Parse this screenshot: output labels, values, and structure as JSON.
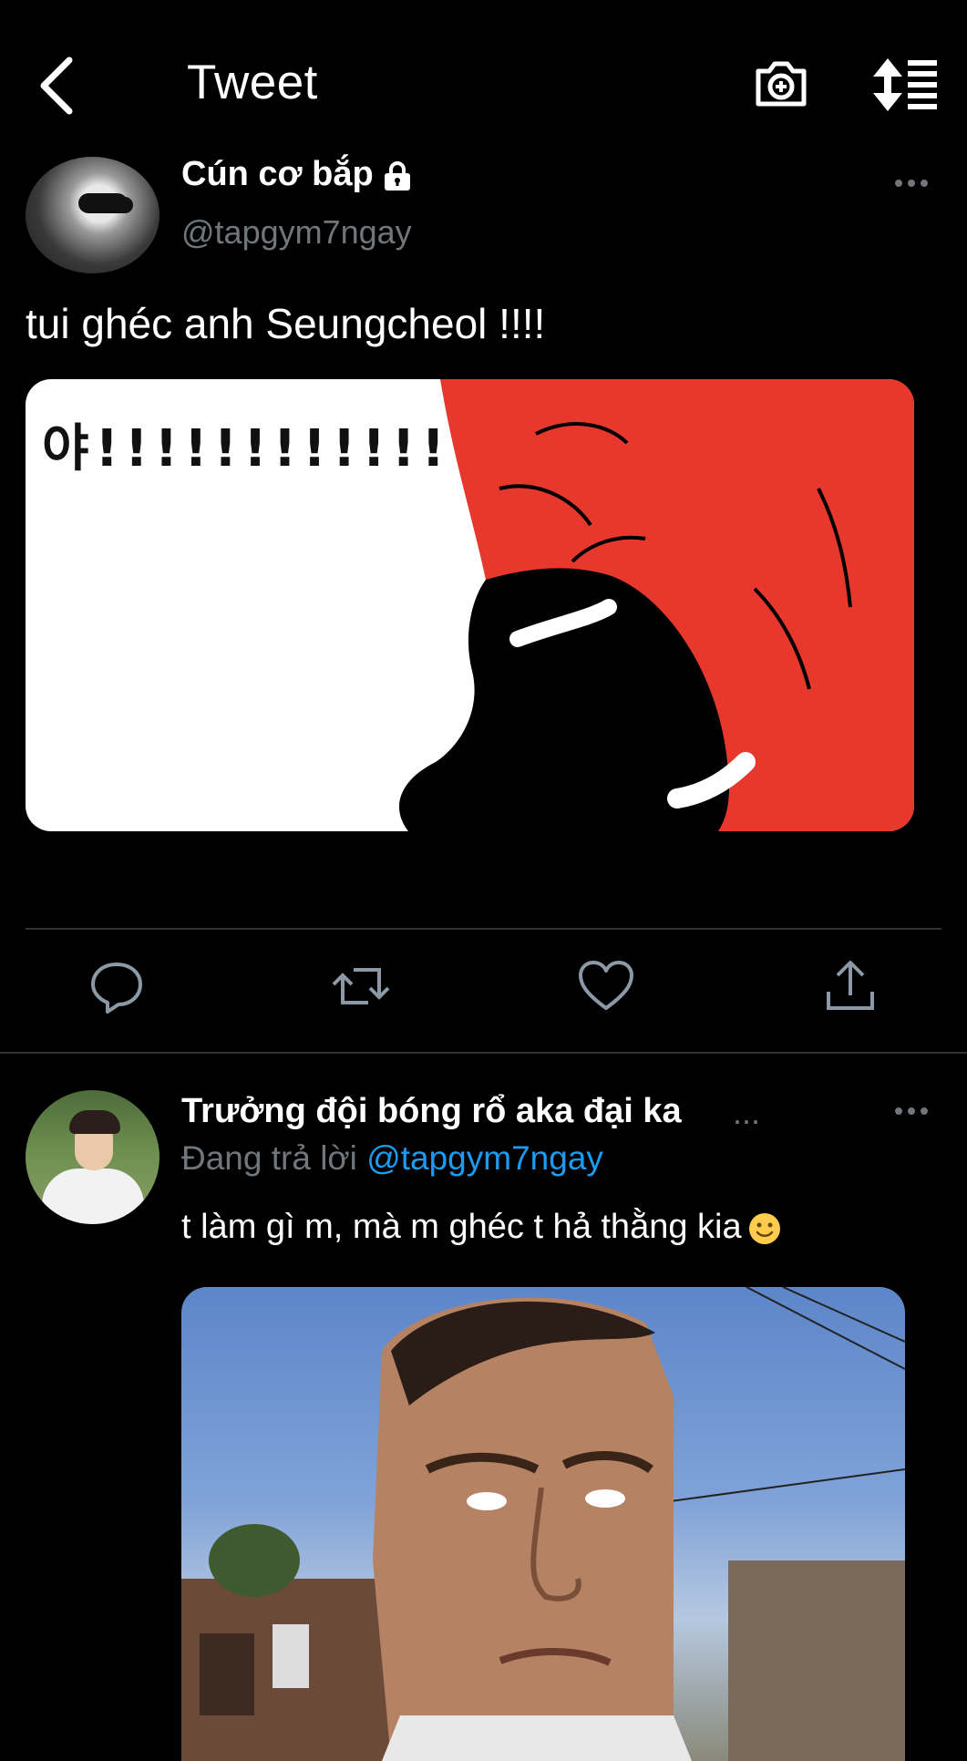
{
  "header": {
    "title": "Tweet"
  },
  "main_tweet": {
    "display_name": "Cún cơ bắp",
    "handle": "@tapgym7ngay",
    "text": "tui ghéc anh Seungcheol !!!!",
    "media_text": "야!!!!!!!!!!!!!!!!!!!!!!!!!!!!!!!!!!!!!!!!!!!!!!!!!!!!!"
  },
  "reply_tweet": {
    "display_name": "Trưởng đội bóng rổ aka đại ka",
    "name_truncation": "...",
    "replying_prefix": "Đang trả lời",
    "replying_handle": "@tapgym7ngay",
    "text": "t làm gì m, mà m ghéc t hả thằng kia"
  },
  "icons": {
    "back": "chevron-left-icon",
    "camera": "camera-plus-icon",
    "sort": "sort-icon",
    "lock": "lock-icon",
    "more": "more-dots-icon",
    "reply": "reply-icon",
    "retweet": "retweet-icon",
    "like": "heart-icon",
    "share": "share-icon",
    "emoji": "slightly-smiling-face-emoji"
  },
  "colors": {
    "background": "#000000",
    "text_primary": "#ffffff",
    "text_secondary": "#71767b",
    "link": "#1d9bf0",
    "divider": "#2f3336",
    "meme_red": "#e8372c"
  }
}
